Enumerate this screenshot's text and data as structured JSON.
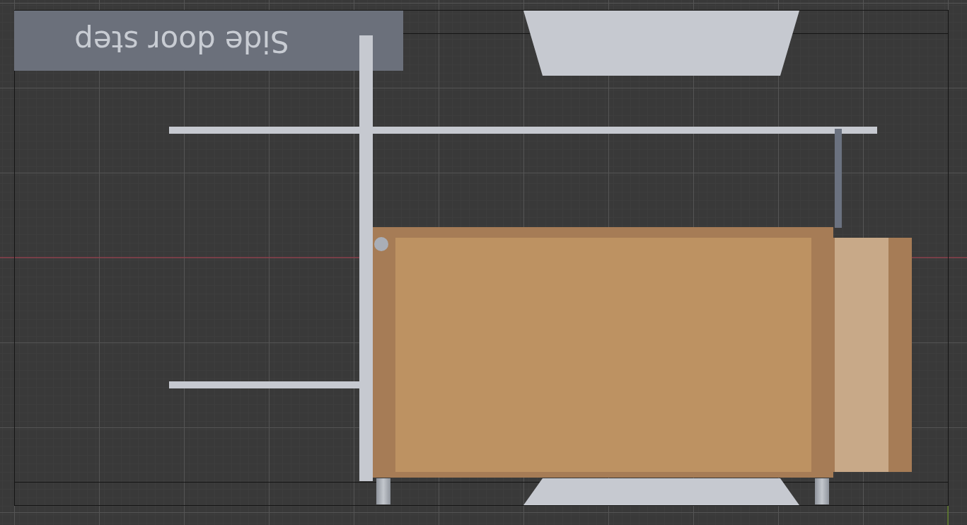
{
  "viewport": {
    "label": "Side door step"
  }
}
